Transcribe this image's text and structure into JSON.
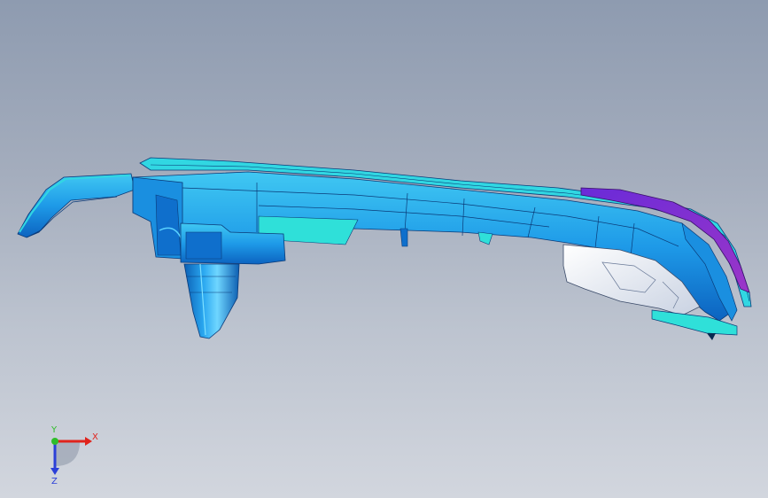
{
  "viewport": {
    "background_top": "#8e9bb0",
    "background_bottom": "#d2d6de"
  },
  "model": {
    "name": "",
    "colors": {
      "body": "#1e9ae8",
      "body_dark": "#0b5fb5",
      "face_light": "#39c6ee",
      "rim": "#31d7e2",
      "insert": "#8b2fd0",
      "white_part": "#f2f4f8",
      "edge": "#0a3a78"
    }
  },
  "triad": {
    "x_label": "X",
    "y_label": "Y",
    "z_label": "Z",
    "x_color": "#e0231c",
    "y_color": "#2fbd2a",
    "z_color": "#2b3fd8"
  }
}
